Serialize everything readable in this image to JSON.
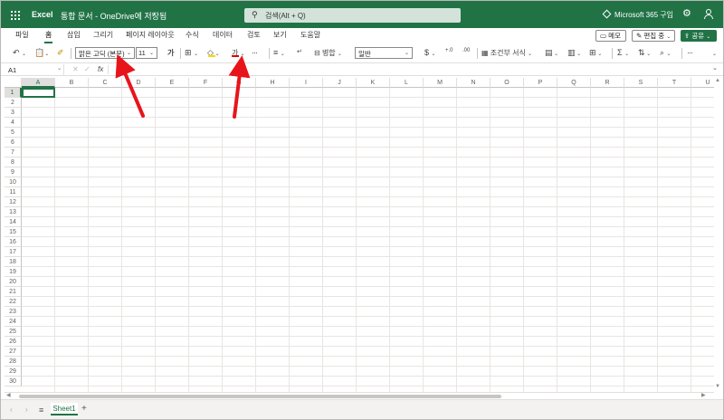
{
  "titlebar": {
    "app_name": "Excel",
    "doc_title": "통합 문서 - OneDrive에 저장됨",
    "search_placeholder": "검색(Alt + Q)",
    "m365_label": "Microsoft 365 구입",
    "bg_color": "#217346"
  },
  "menu": {
    "tabs": [
      "파일",
      "홈",
      "삽입",
      "그리기",
      "페이지 레이아웃",
      "수식",
      "데이터",
      "검토",
      "보기",
      "도움말"
    ],
    "active_tab": "홈",
    "memo_label": "메모",
    "edit_label": "편집 중",
    "share_label": "공유"
  },
  "ribbon": {
    "font_name": "맑은 고딕 (본문)",
    "font_size": "11",
    "bold_glyph": "가",
    "font_color_glyph": "가",
    "merge_label": "병합",
    "number_format": "일반",
    "currency_glyph": "$",
    "conditional_format_label": "조건부 서식",
    "more_glyph": "···",
    "fill_color": "#ffd600",
    "font_color": "#e00000"
  },
  "formula_bar": {
    "name_box": "A1",
    "fx_label": "fx"
  },
  "grid": {
    "columns": [
      "A",
      "B",
      "C",
      "D",
      "E",
      "F",
      "G",
      "H",
      "I",
      "J",
      "K",
      "L",
      "M",
      "N",
      "O",
      "P",
      "Q",
      "R",
      "S",
      "T",
      "U"
    ],
    "rows": [
      "1",
      "2",
      "3",
      "4",
      "5",
      "6",
      "7",
      "8",
      "9",
      "10",
      "11",
      "12",
      "13",
      "14",
      "15",
      "16",
      "17",
      "18",
      "19",
      "20",
      "21",
      "22",
      "23",
      "24",
      "25",
      "26",
      "27",
      "28",
      "29",
      "30"
    ],
    "active_cell": "A1"
  },
  "sheets": {
    "tabs": [
      "Sheet1"
    ],
    "add_glyph": "+"
  }
}
